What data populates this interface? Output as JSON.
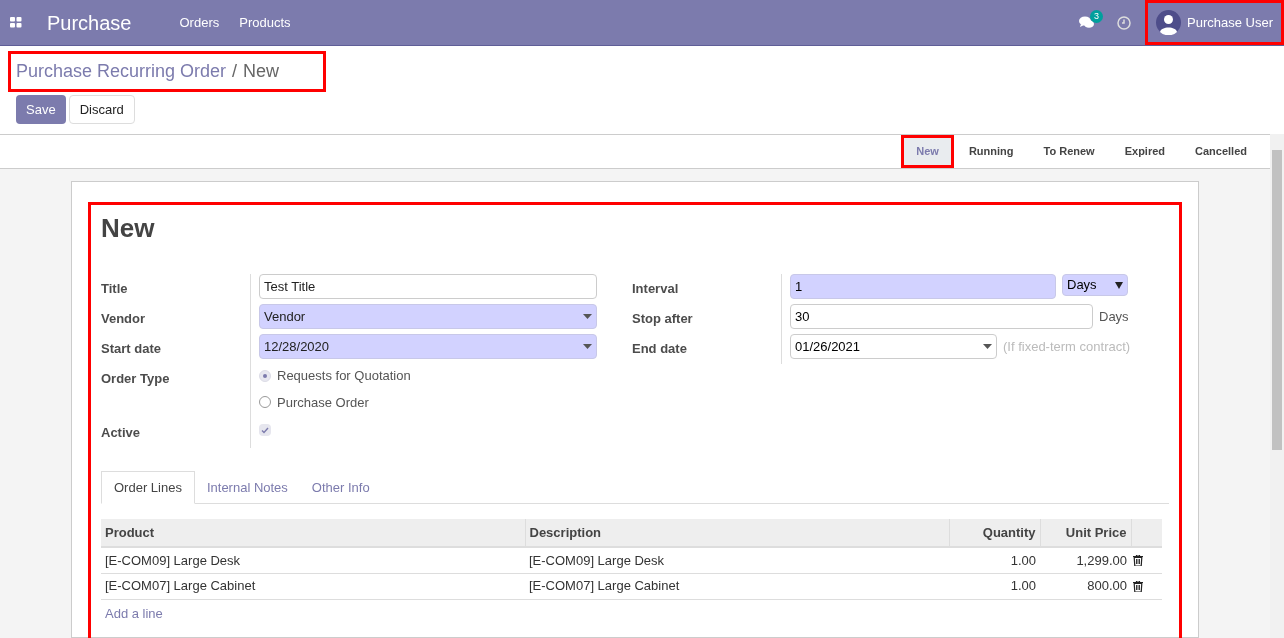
{
  "navbar": {
    "app_title": "Purchase",
    "menu": [
      "Orders",
      "Products"
    ],
    "messages_badge": "3",
    "user": {
      "name": "Purchase User",
      "highlighted": true
    }
  },
  "breadcrumb": {
    "parent": "Purchase Recurring Order",
    "separator": "/",
    "current": "New",
    "highlighted": true
  },
  "buttons": [
    "Save",
    "Discard"
  ],
  "stages": [
    {
      "label": "New",
      "selected": true,
      "highlighted": true
    },
    {
      "label": "Running",
      "selected": false,
      "highlighted": false
    },
    {
      "label": "To Renew",
      "selected": false,
      "highlighted": false
    },
    {
      "label": "Expired",
      "selected": false,
      "highlighted": false
    },
    {
      "label": "Cancelled",
      "selected": false,
      "highlighted": false
    }
  ],
  "form": {
    "highlighted": true,
    "title": "New",
    "left_fields": [
      {
        "kind": "text",
        "label": "Title",
        "value": "Test Title",
        "required": false
      },
      {
        "kind": "select",
        "label": "Vendor",
        "value": "Vendor",
        "required": true
      },
      {
        "kind": "select",
        "label": "Start date",
        "value": "12/28/2020",
        "required": true
      },
      {
        "kind": "radio",
        "label": "Order Type",
        "options": [
          {
            "label": "Requests for Quotation",
            "selected": true
          },
          {
            "label": "Purchase Order",
            "selected": false
          }
        ]
      },
      {
        "kind": "checkbox",
        "label": "Active",
        "checked": true
      }
    ],
    "right_fields": [
      {
        "kind": "interval",
        "label": "Interval",
        "value": "1",
        "unit": "Days"
      },
      {
        "kind": "suffix",
        "label": "Stop after",
        "value": "30",
        "suffix": "Days"
      },
      {
        "kind": "date",
        "label": "End date",
        "value": "01/26/2021",
        "hint": "(If fixed-term contract)"
      }
    ],
    "tabs": [
      {
        "label": "Order Lines",
        "selected": true
      },
      {
        "label": "Internal Notes",
        "selected": false
      },
      {
        "label": "Other Info",
        "selected": false
      }
    ],
    "table": {
      "columns": [
        "Product",
        "Description",
        "Quantity",
        "Unit Price"
      ],
      "rows": [
        [
          "[E-COM09] Large Desk",
          "[E-COM09] Large Desk",
          "1.00",
          "1,299.00"
        ],
        [
          "[E-COM07] Large Cabinet",
          "[E-COM07] Large Cabinet",
          "1.00",
          "800.00"
        ]
      ],
      "add_line": "Add a line"
    }
  }
}
